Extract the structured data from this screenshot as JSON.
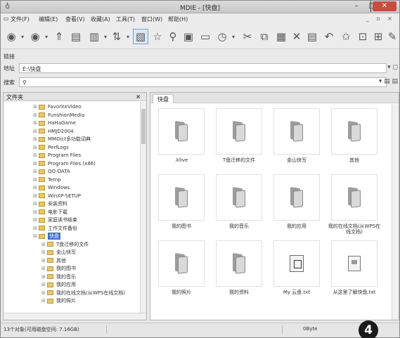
{
  "window": {
    "title": "MDIE - [快盘]"
  },
  "menu": [
    "文件(F)",
    "编辑(E)",
    "查看(V)",
    "收藏(A)",
    "工具(T)",
    "窗口(W)",
    "帮助(H)"
  ],
  "toolbar_icons": [
    "back-icon",
    "forward-icon",
    "up-icon",
    "properties-icon",
    "view-icon",
    "sort-icon",
    "select-icon",
    "favorite-icon",
    "search-icon",
    "copy-path-icon",
    "folder-icon",
    "history-icon",
    "cut-icon",
    "copy-icon",
    "paste-icon",
    "delete-icon",
    "rename-icon",
    "undo-icon",
    "star-icon",
    "lock-icon",
    "grid-icon",
    "edit-icon"
  ],
  "labels": {
    "links": "链接",
    "address": "地址",
    "search": "搜索",
    "folders": "文件夹",
    "folders_close": "×"
  },
  "address": {
    "value": "E:\\快盘"
  },
  "search": {
    "value": ""
  },
  "tree": [
    {
      "label": "FavoriteVideo",
      "depth": 1
    },
    {
      "label": "FunshionMedia",
      "depth": 1
    },
    {
      "label": "HaHaGame",
      "depth": 1
    },
    {
      "label": "HMJD2004",
      "depth": 1
    },
    {
      "label": "MMDict多功能词典",
      "depth": 1
    },
    {
      "label": "PerfLogs",
      "depth": 1
    },
    {
      "label": "Program Files",
      "depth": 1
    },
    {
      "label": "Program Files (x86)",
      "depth": 1
    },
    {
      "label": "QQ-DATA",
      "depth": 1
    },
    {
      "label": "Temp",
      "depth": 1
    },
    {
      "label": "Windows",
      "depth": 1
    },
    {
      "label": "WinXP-SETUP",
      "depth": 1
    },
    {
      "label": "安装资料",
      "depth": 1
    },
    {
      "label": "电影下载",
      "depth": 1
    },
    {
      "label": "家庭读书结束",
      "depth": 1
    },
    {
      "label": "工作文件备份",
      "depth": 1
    },
    {
      "label": "快盘",
      "depth": 1,
      "selected": true
    },
    {
      "label": "T盘迁移的文件",
      "depth": 2
    },
    {
      "label": "金山快写",
      "depth": 2
    },
    {
      "label": "其他",
      "depth": 2
    },
    {
      "label": "我的图书",
      "depth": 2
    },
    {
      "label": "我的音乐",
      "depth": 2
    },
    {
      "label": "我的应用",
      "depth": 2
    },
    {
      "label": "我的在线文档(从WPS在线文档)",
      "depth": 2
    },
    {
      "label": "我的照片",
      "depth": 2
    }
  ],
  "tab": {
    "label": "快盘"
  },
  "files": [
    {
      "name": ".klive",
      "type": "folder"
    },
    {
      "name": "T盘迁移的文件",
      "type": "folder"
    },
    {
      "name": "金山快写",
      "type": "folder"
    },
    {
      "name": "其他",
      "type": "folder"
    },
    {
      "name": "我的图书",
      "type": "folder"
    },
    {
      "name": "我的音乐",
      "type": "folder"
    },
    {
      "name": "我的应用",
      "type": "folder"
    },
    {
      "name": "我的在线文档(从WPS在线文档)",
      "type": "folder"
    },
    {
      "name": "我的照片",
      "type": "folder"
    },
    {
      "name": "我的资料",
      "type": "folder"
    },
    {
      "name": "My 云盘.txt",
      "type": "doc"
    },
    {
      "name": "从这里了解快盘.txt",
      "type": "doc2"
    }
  ],
  "status": {
    "left": "13个对象(可用磁盘空间: 7.16GB)",
    "size": "0Byte"
  },
  "badge": "4"
}
